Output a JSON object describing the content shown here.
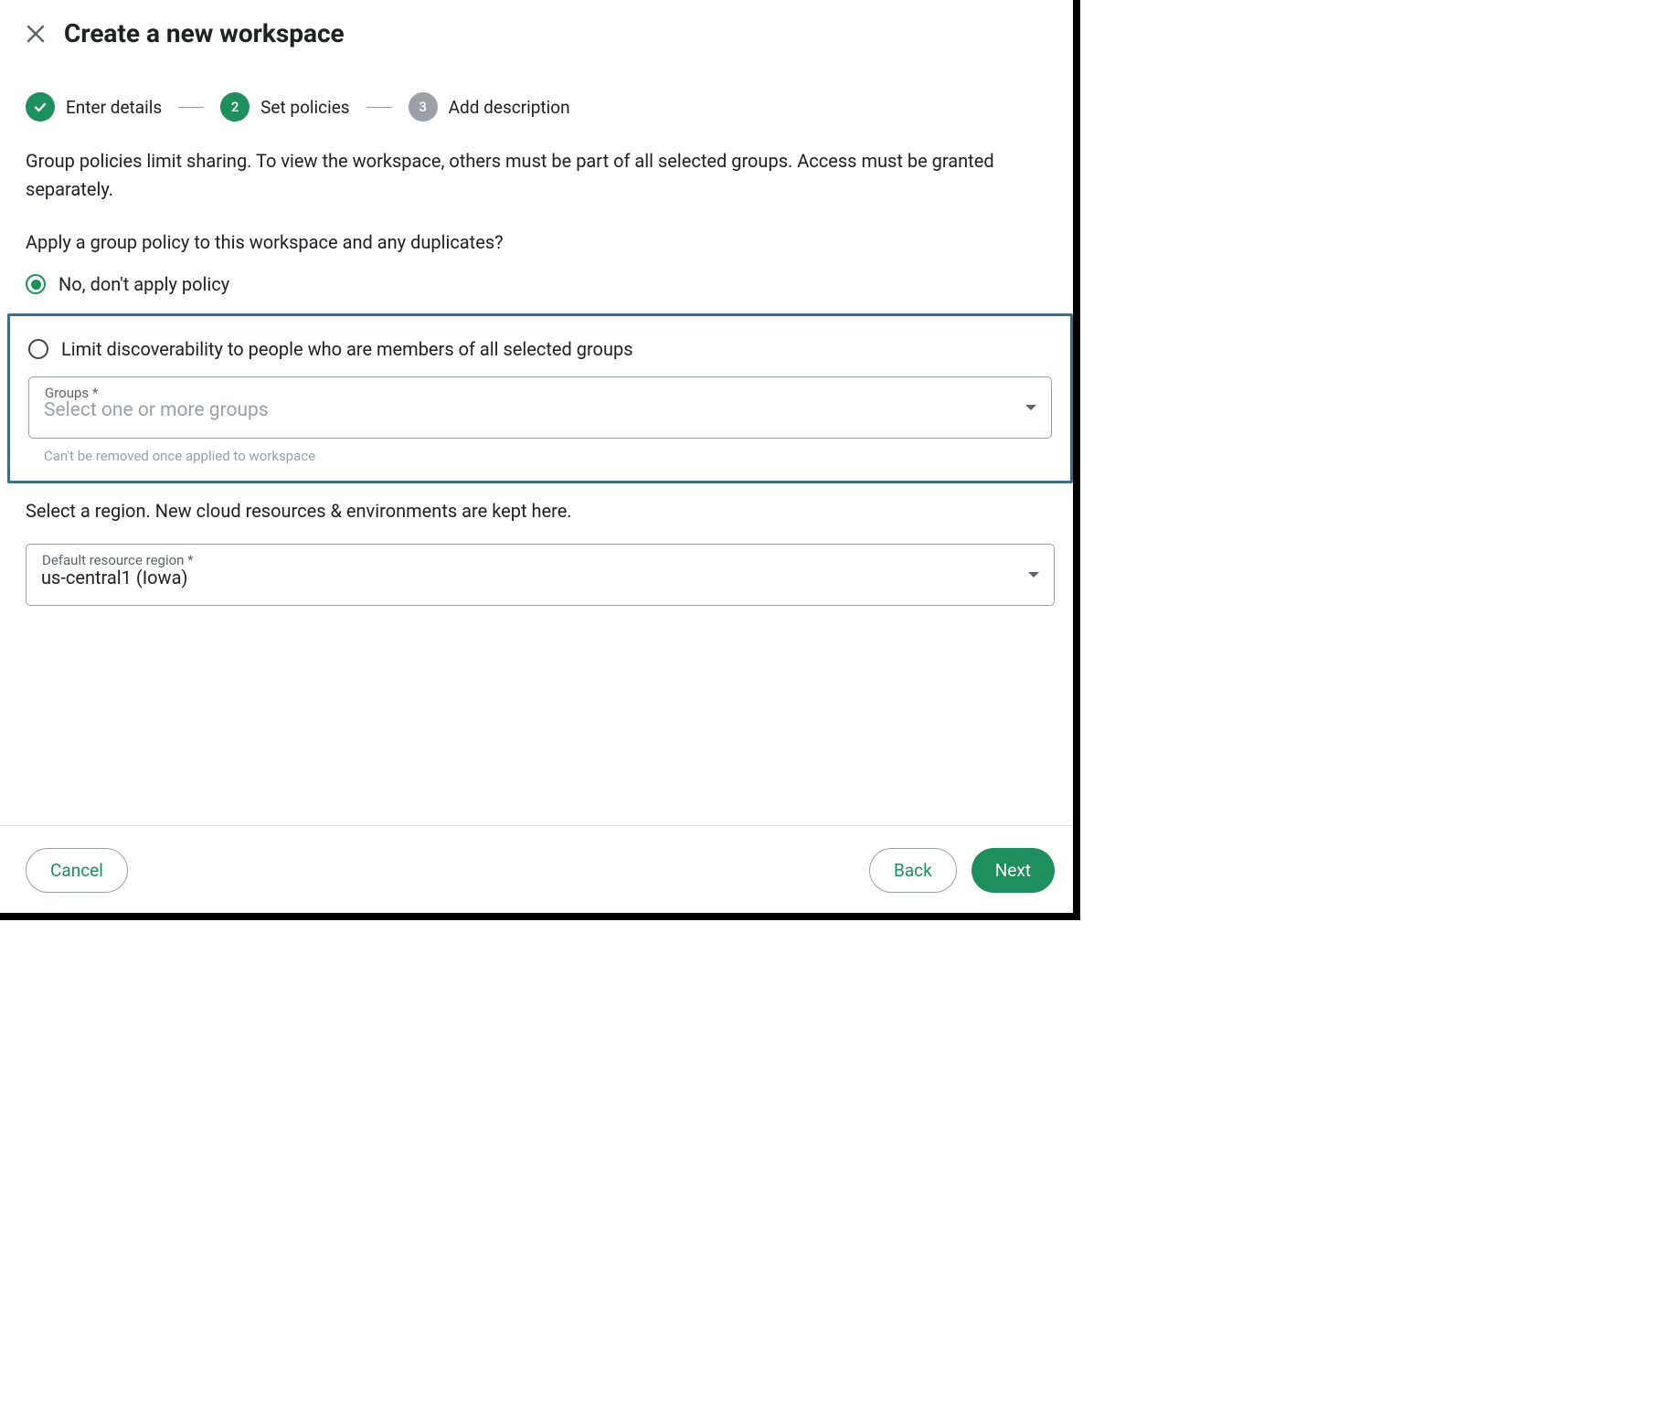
{
  "header": {
    "title": "Create a new workspace"
  },
  "steps": {
    "s1": {
      "label": "Enter details"
    },
    "s2": {
      "num": "2",
      "label": "Set policies"
    },
    "s3": {
      "num": "3",
      "label": "Add description"
    }
  },
  "policy": {
    "description": "Group policies limit sharing. To view the workspace, others must be part of all selected groups. Access must be granted separately.",
    "question": "Apply a group policy to this workspace and any duplicates?",
    "option_no": "No, don't apply policy",
    "option_limit": "Limit discoverability to people who are members of all selected groups",
    "groups_label": "Groups *",
    "groups_placeholder": "Select one or more groups",
    "groups_helper": "Can't be removed once applied to workspace"
  },
  "region": {
    "description": "Select a region. New cloud resources & environments are kept here.",
    "label": "Default resource region *",
    "value": "us-central1 (Iowa)"
  },
  "footer": {
    "cancel": "Cancel",
    "back": "Back",
    "next": "Next"
  }
}
